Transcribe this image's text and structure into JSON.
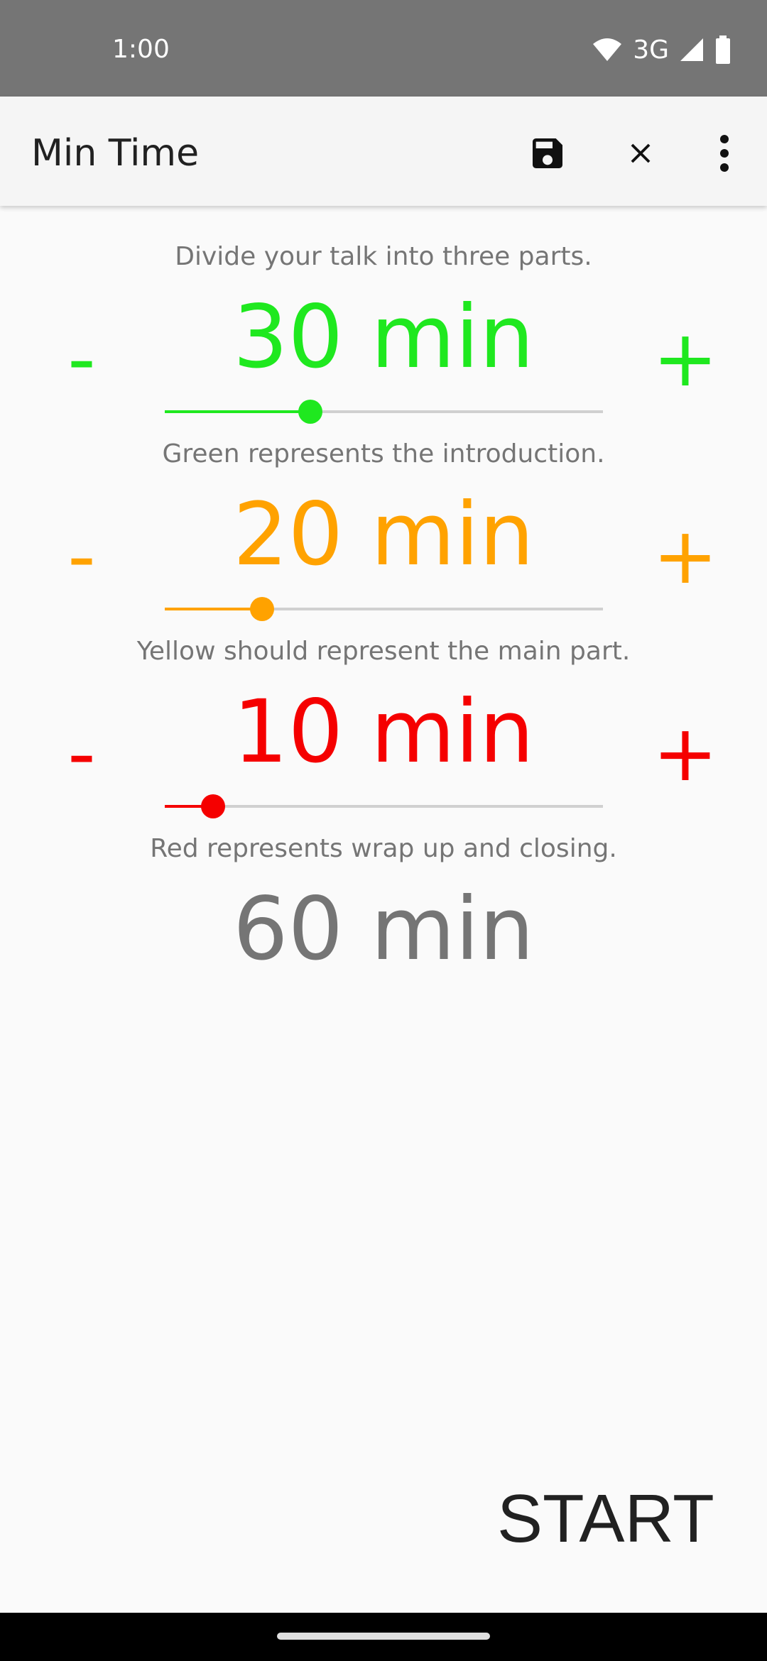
{
  "status_bar": {
    "time": "1:00",
    "network": "3G",
    "icons": [
      "wifi-icon",
      "cell-signal-icon",
      "battery-icon"
    ]
  },
  "app_bar": {
    "title": "Min Time",
    "actions": [
      "save-icon",
      "close-icon",
      "more-vert-icon"
    ]
  },
  "intro_text": "Divide your talk into three parts.",
  "sections": [
    {
      "color": "#1fe81f",
      "duration_label": "30 min",
      "minus": "-",
      "plus": "+",
      "slider_fraction": 0.333,
      "description": "Green represents the introduction."
    },
    {
      "color": "#ffa200",
      "duration_label": "20 min",
      "minus": "-",
      "plus": "+",
      "slider_fraction": 0.222,
      "description": "Yellow should represent the main part."
    },
    {
      "color": "#f50000",
      "duration_label": "10 min",
      "minus": "-",
      "plus": "+",
      "slider_fraction": 0.111,
      "description": "Red represents wrap up and closing."
    }
  ],
  "total": {
    "label": "60 min",
    "color": "#757575"
  },
  "start_label": "START"
}
